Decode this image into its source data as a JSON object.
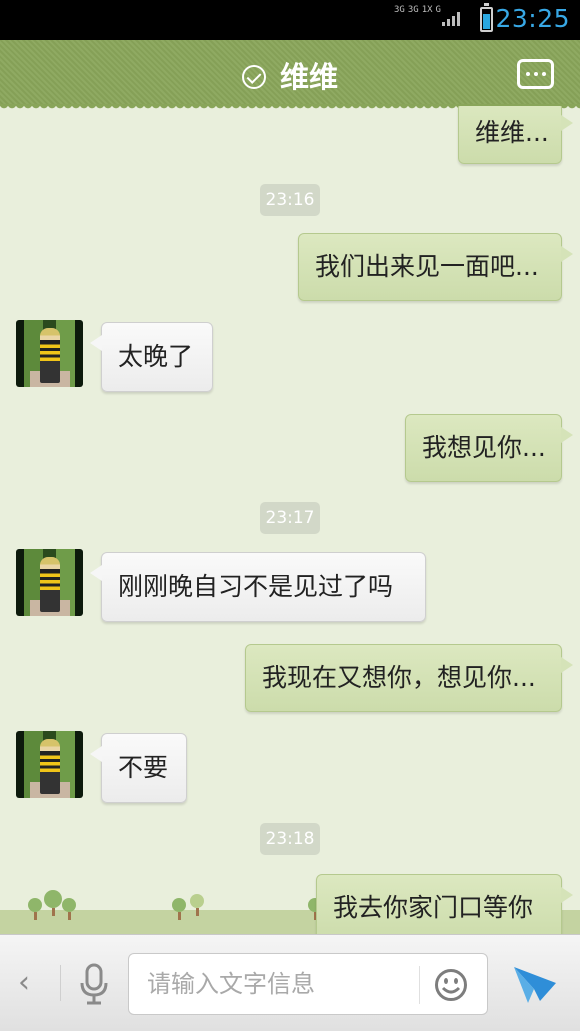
{
  "status_bar": {
    "network_labels": [
      "3G",
      "3G",
      "1X",
      "G"
    ],
    "time": "23:25"
  },
  "header": {
    "title": "维维",
    "icons": [
      "verified-check-icon",
      "more-options-icon"
    ],
    "accent_color": "#89a55a"
  },
  "messages": [
    {
      "type": "out",
      "text": "维维..."
    },
    {
      "type": "time",
      "text": "23:16"
    },
    {
      "type": "out",
      "text": "我们出来见一面吧..."
    },
    {
      "type": "in",
      "text": "太晚了"
    },
    {
      "type": "out",
      "text": "我想见你..."
    },
    {
      "type": "time",
      "text": "23:17"
    },
    {
      "type": "in",
      "text": "刚刚晚自习不是见过了吗"
    },
    {
      "type": "out",
      "text": "我现在又想你，想见你..."
    },
    {
      "type": "in",
      "text": "不要"
    },
    {
      "type": "time",
      "text": "23:18"
    },
    {
      "type": "out",
      "text": "我去你家门口等你"
    }
  ],
  "input_bar": {
    "placeholder": "请输入文字信息",
    "back_label": "‹",
    "icons": [
      "back-chevron-icon",
      "microphone-icon",
      "emoji-icon",
      "send-icon"
    ]
  },
  "colors": {
    "outgoing_bubble": "#d5e3b8",
    "incoming_bubble": "#f4f4f4",
    "chat_background": "#e9efdc",
    "clock": "#38a8e5",
    "send_icon": "#2f8ed8"
  }
}
